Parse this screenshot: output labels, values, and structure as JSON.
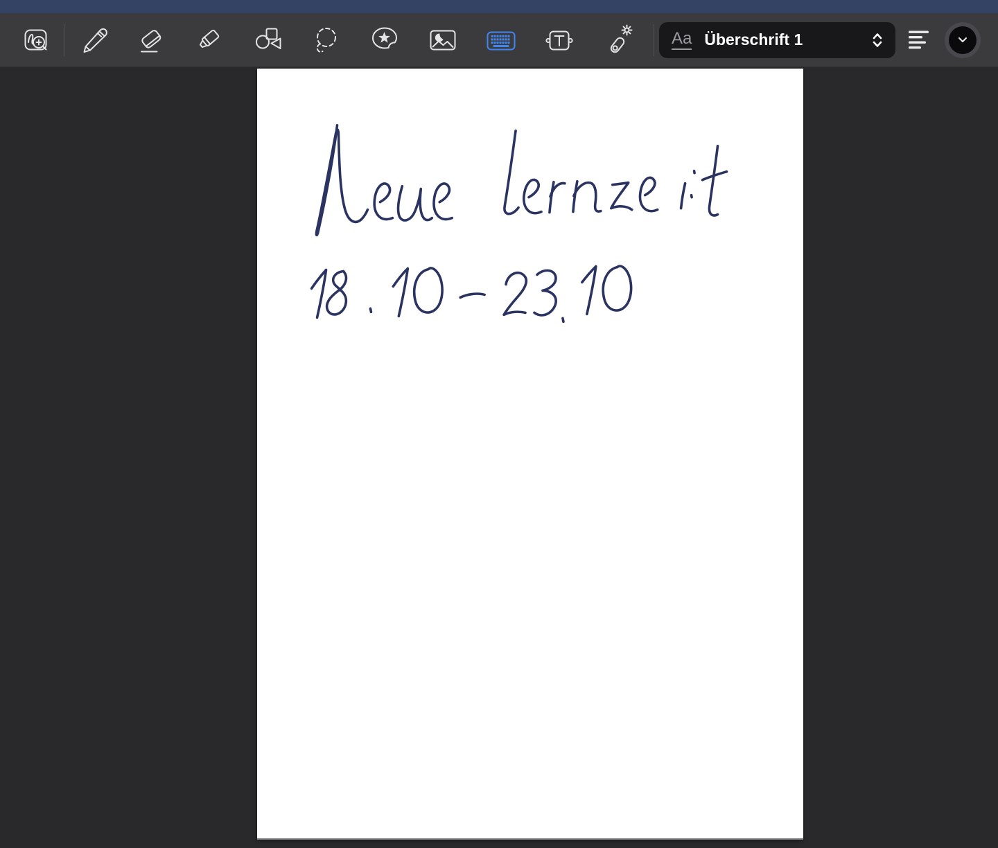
{
  "colors": {
    "status_bar": "#344263",
    "toolbar_background": "#3b3b3d",
    "canvas_background": "#29292b",
    "page_background": "#ffffff",
    "active_tool_blue": "#3f87f5",
    "icon_gray": "#e4e4e6",
    "ink_navy": "#2b3460"
  },
  "toolbar": {
    "tools": [
      {
        "name": "zoom-window",
        "active": false
      },
      {
        "name": "pen",
        "active": false
      },
      {
        "name": "eraser",
        "active": false
      },
      {
        "name": "highlighter",
        "active": false
      },
      {
        "name": "shapes",
        "active": false
      },
      {
        "name": "lasso",
        "active": false
      },
      {
        "name": "stickers",
        "active": false
      },
      {
        "name": "image",
        "active": false
      },
      {
        "name": "keyboard",
        "active": true
      },
      {
        "name": "text",
        "active": false
      },
      {
        "name": "laser-pointer",
        "active": false
      }
    ],
    "style_picker": {
      "font_button_label": "Aa",
      "selected_style": "Überschrift 1"
    }
  },
  "page": {
    "handwriting": {
      "line1": "Neue Lernzeit",
      "line2": "18.10 - 23.10"
    }
  }
}
